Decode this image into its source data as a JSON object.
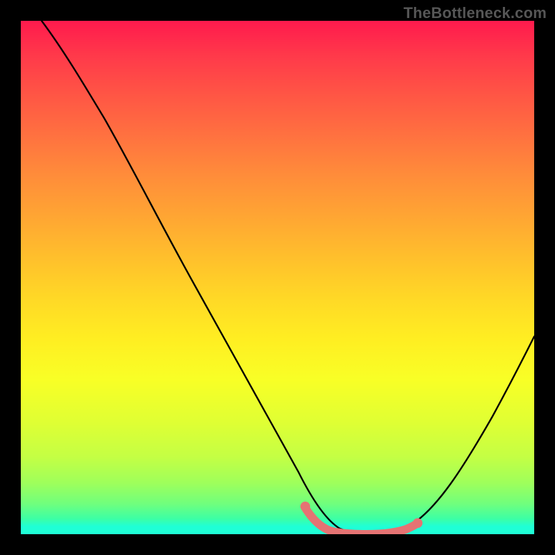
{
  "watermark": "TheBottleneck.com",
  "chart_data": {
    "type": "line",
    "title": "",
    "xlabel": "",
    "ylabel": "",
    "xlim": [
      0,
      100
    ],
    "ylim": [
      0,
      100
    ],
    "series": [
      {
        "name": "curve",
        "color": "#000000",
        "x": [
          4,
          8,
          12,
          16,
          20,
          24,
          28,
          32,
          36,
          40,
          44,
          48,
          52,
          55,
          58,
          62,
          66,
          70,
          74,
          78,
          82,
          86,
          90,
          94,
          98,
          100
        ],
        "y": [
          100,
          95,
          89,
          83,
          76,
          69,
          62,
          55,
          47,
          40,
          32,
          24,
          16,
          9,
          4,
          1,
          0,
          0,
          0.5,
          2,
          5,
          10,
          16,
          23,
          31,
          35
        ]
      },
      {
        "name": "highlight",
        "color": "#e57373",
        "x": [
          55,
          58,
          62,
          66,
          70,
          74,
          76
        ],
        "y": [
          4,
          2,
          0.5,
          0,
          0,
          0.5,
          1
        ]
      }
    ],
    "gradient_stops": [
      {
        "pos": 0,
        "color": "#ff1a4d"
      },
      {
        "pos": 0.5,
        "color": "#ffee22"
      },
      {
        "pos": 0.97,
        "color": "#3cffa5"
      },
      {
        "pos": 1.0,
        "color": "#1fffd6"
      }
    ]
  },
  "colors": {
    "background": "#000000",
    "watermark": "#565656",
    "curve": "#000000",
    "highlight": "#e57373"
  }
}
